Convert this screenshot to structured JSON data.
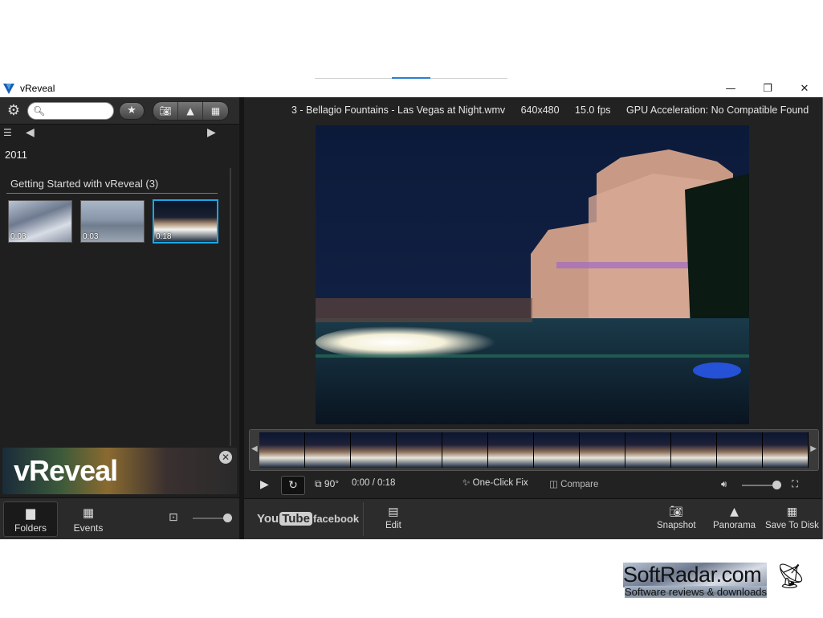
{
  "app": {
    "title": "vReveal"
  },
  "window_controls": {
    "minimize": "—",
    "restore": "❐",
    "close": "✕"
  },
  "left": {
    "search": {
      "placeholder": ""
    },
    "nav": {
      "prev": "◀",
      "next": "▶"
    },
    "year": "2011",
    "group_title": "Getting Started with vReveal (3)",
    "thumbnails": [
      {
        "duration": "0:08"
      },
      {
        "duration": "0:03"
      },
      {
        "duration": "0:18",
        "selected": true
      }
    ],
    "brand": {
      "text": "vReveal"
    },
    "bottom": {
      "folders_label": "Folders",
      "events_label": "Events"
    },
    "zoom_level": 0.9
  },
  "main": {
    "info": {
      "filename": "3 - Bellagio Fountains - Las Vegas at Night.wmv",
      "resolution": "640x480",
      "fps": "15.0 fps",
      "gpu": "GPU Acceleration: No Compatible Found"
    },
    "controls": {
      "rotate": "90°",
      "time": "0:00 / 0:18",
      "one_click_fix": "One-Click Fix",
      "compare": "Compare",
      "volume_level": 0.9
    },
    "share": {
      "youtube_a": "You",
      "youtube_b": "Tube",
      "facebook": "facebook"
    },
    "actions": {
      "edit": "Edit",
      "snapshot": "Snapshot",
      "panorama": "Panorama",
      "save_to_disk": "Save To Disk"
    }
  },
  "footer": {
    "brand": "SoftRadar.com",
    "tagline": "Software reviews & downloads"
  },
  "colors": {
    "accent": "#1aa7e8",
    "background": "#232323"
  }
}
